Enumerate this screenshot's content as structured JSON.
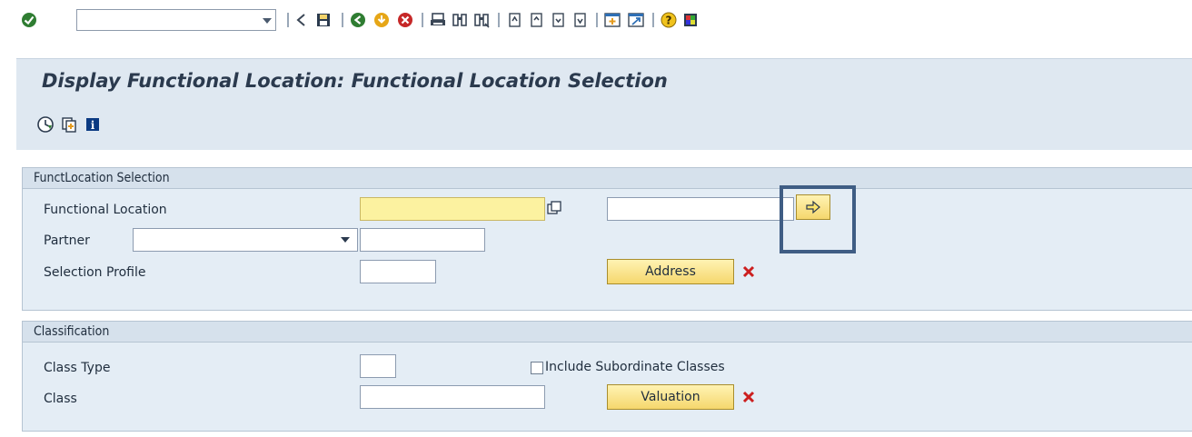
{
  "toolbar": {
    "command_field_value": "",
    "icons": [
      "enter-icon",
      "back-icon",
      "save-icon",
      "exit-icon",
      "cancel-icon",
      "stop-icon",
      "print-icon",
      "find-icon",
      "find-next-icon",
      "first-page-icon",
      "previous-page-icon",
      "next-page-icon",
      "last-page-icon",
      "new-session-icon",
      "create-shortcut-icon",
      "help-icon",
      "customize-layout-icon"
    ]
  },
  "title": "Display Functional Location: Functional Location Selection",
  "app_toolbar": {
    "icons": [
      "execute-icon",
      "get-variant-icon",
      "information-icon"
    ]
  },
  "group1": {
    "header": "FunctLocation Selection",
    "functional_location_label": "Functional Location",
    "functional_location_from": "",
    "functional_location_to": "",
    "partner_label": "Partner",
    "partner_role_value": "",
    "partner_value": "",
    "selection_profile_label": "Selection Profile",
    "selection_profile_value": "",
    "address_button": "Address"
  },
  "group2": {
    "header": "Classification",
    "class_type_label": "Class Type",
    "class_type_value": "",
    "include_subordinate_label": "Include Subordinate Classes",
    "include_subordinate_checked": false,
    "class_label": "Class",
    "class_value": "",
    "valuation_button": "Valuation"
  },
  "colors": {
    "required_field": "#fcf2a0",
    "button_yellow": "#f5d76d",
    "panel_bg": "#e4edf5",
    "highlight_box": "#3f5d84",
    "delete_red": "#cc1f1f"
  }
}
